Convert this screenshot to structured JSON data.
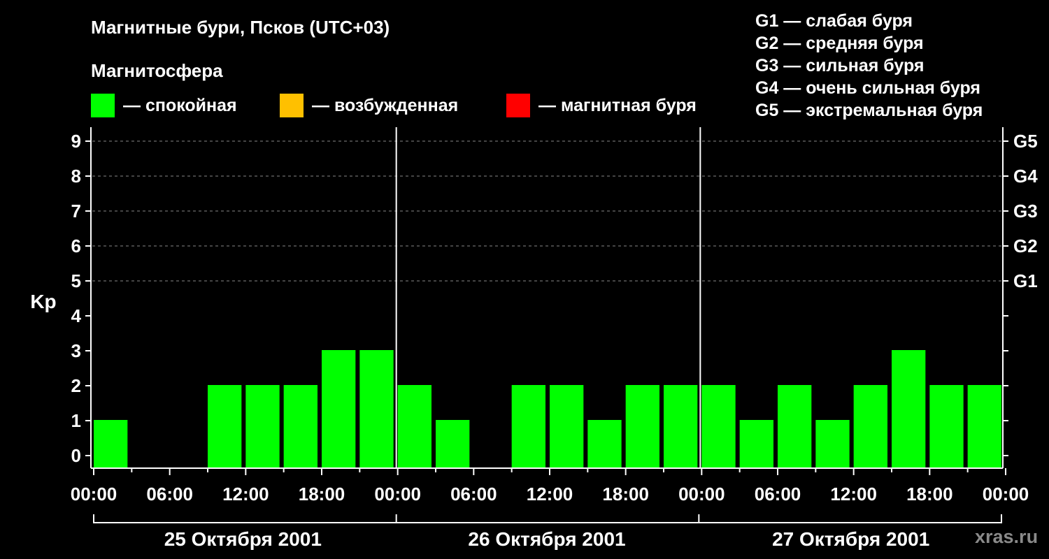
{
  "chart_data": {
    "type": "bar",
    "title": "Магнитные бури, Псков (UTC+03)",
    "subtitle": "Магнитосфера",
    "ylabel": "Kp",
    "ylim": [
      0,
      9
    ],
    "yticks": [
      "0",
      "1",
      "2",
      "3",
      "4",
      "5",
      "6",
      "7",
      "8",
      "9"
    ],
    "right_ticks": [
      {
        "kp": 5,
        "label": "G1"
      },
      {
        "kp": 6,
        "label": "G2"
      },
      {
        "kp": 7,
        "label": "G3"
      },
      {
        "kp": 8,
        "label": "G4"
      },
      {
        "kp": 9,
        "label": "G5"
      }
    ],
    "grid": "dashed horizontal at Kp 5-9",
    "xtick_labels": [
      "00:00",
      "06:00",
      "12:00",
      "18:00",
      "00:00",
      "06:00",
      "12:00",
      "18:00",
      "00:00",
      "06:00",
      "12:00",
      "18:00",
      "00:00"
    ],
    "days": [
      "25 Октября 2001",
      "26 Октября 2001",
      "27 Октября 2001"
    ],
    "interval_hours": 3,
    "values": [
      1,
      0,
      0,
      2,
      2,
      2,
      3,
      3,
      2,
      1,
      0,
      2,
      2,
      1,
      2,
      2,
      2,
      1,
      2,
      1,
      2,
      3,
      2,
      2
    ],
    "legend_title": "Магнитосфера",
    "legend": [
      {
        "label": "— спокойная",
        "color": "#00ff00"
      },
      {
        "label": "— возбужденная",
        "color": "#ffc000"
      },
      {
        "label": "— магнитная буря",
        "color": "#ff0000"
      }
    ],
    "gscale": [
      "G1 — слабая буря",
      "G2 — средняя буря",
      "G3 — сильная буря",
      "G4 — очень сильная буря",
      "G5 — экстремальная буря"
    ],
    "colors": {
      "background": "#000000",
      "bar": "#00ff00",
      "axis": "#ffffff",
      "grid": "#888888"
    }
  },
  "watermark": "xras.ru"
}
